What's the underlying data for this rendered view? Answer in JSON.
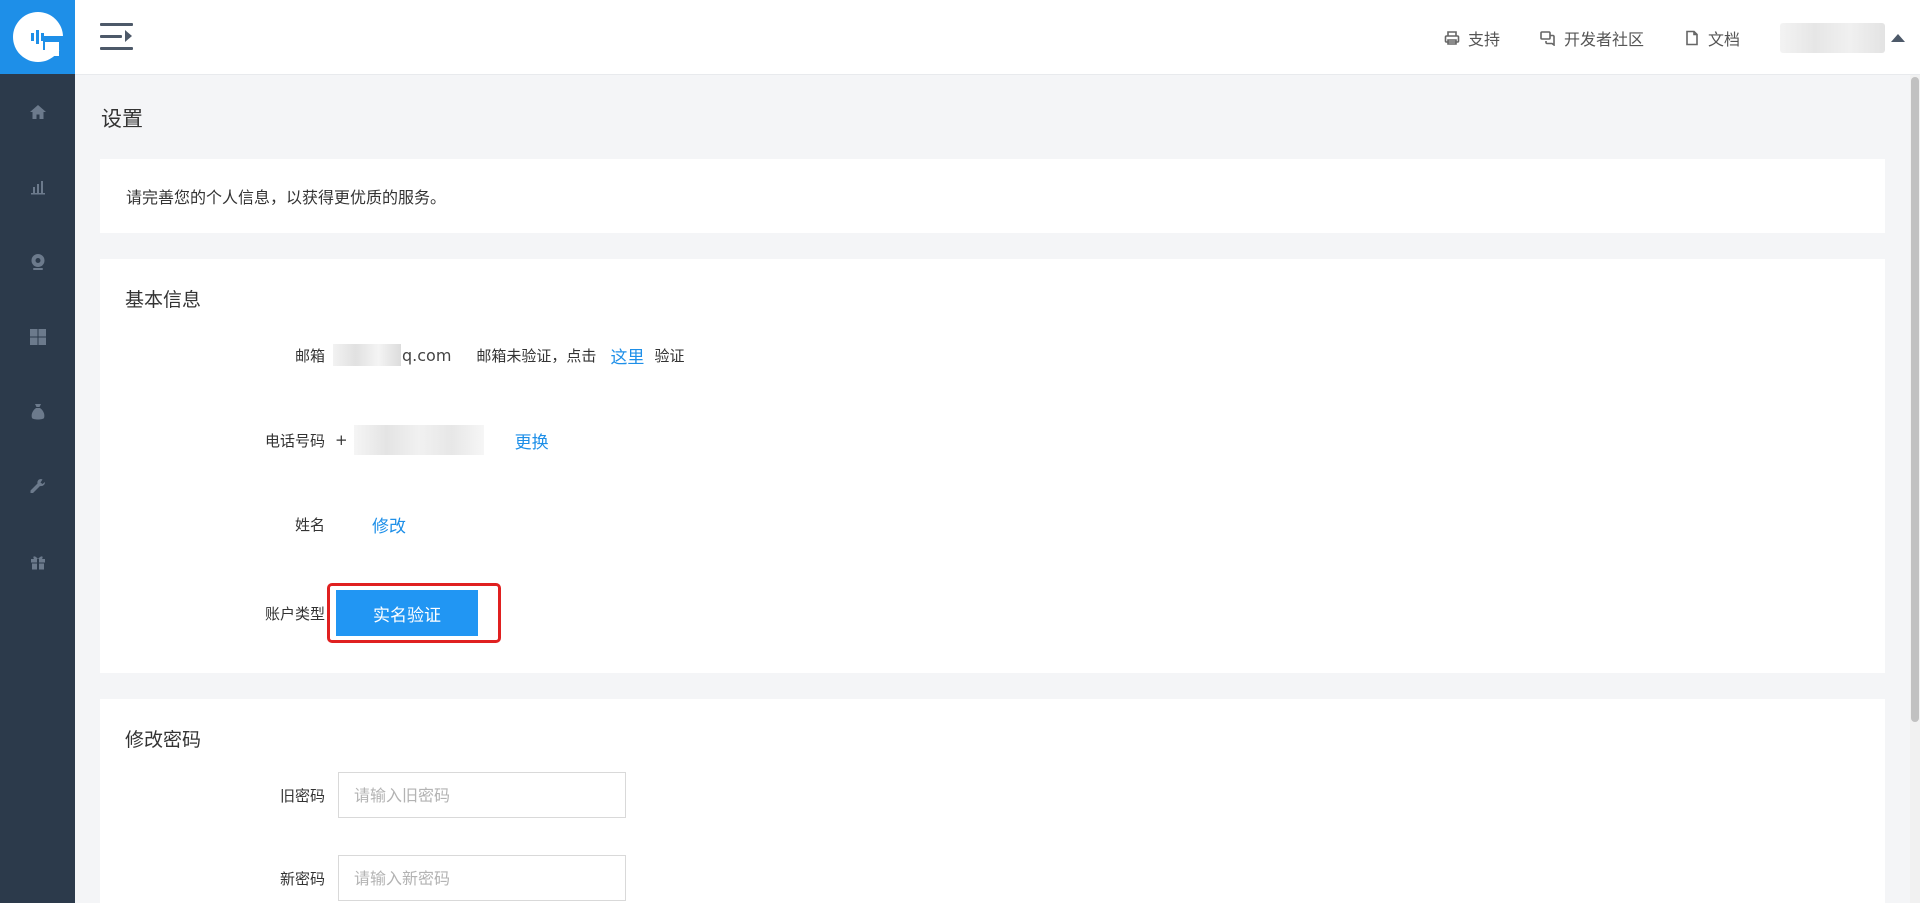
{
  "colors": {
    "sidebar_bg": "#2c3a4b",
    "accent": "#1e8fe8",
    "button_bg": "#2196f3",
    "highlight_border": "#e02020"
  },
  "sidebar": {
    "items": [
      {
        "icon": "home-icon"
      },
      {
        "icon": "bar-chart-icon"
      },
      {
        "icon": "webcam-icon"
      },
      {
        "icon": "grid-icon"
      },
      {
        "icon": "money-bag-icon"
      },
      {
        "icon": "wrench-icon"
      },
      {
        "icon": "gift-icon"
      }
    ]
  },
  "header": {
    "links": [
      {
        "label": "支持",
        "icon": "printer-icon"
      },
      {
        "label": "开发者社区",
        "icon": "chat-bubbles-icon"
      },
      {
        "label": "文档",
        "icon": "document-icon"
      }
    ]
  },
  "page": {
    "title": "设置",
    "notice": "请完善您的个人信息，以获得更优质的服务。"
  },
  "basic_info": {
    "title": "基本信息",
    "email": {
      "label": "邮箱",
      "value_suffix": "q.com",
      "status_text": "邮箱未验证，点击",
      "link": "这里",
      "after_link": "验证"
    },
    "phone": {
      "label": "电话号码",
      "prefix": "+",
      "change_link": "更换"
    },
    "name": {
      "label": "姓名",
      "edit_link": "修改"
    },
    "account_type": {
      "label": "账户类型",
      "button": "实名验证"
    }
  },
  "password": {
    "title": "修改密码",
    "old_label": "旧密码",
    "old_placeholder": "请输入旧密码",
    "new_label": "新密码",
    "new_placeholder": "请输入新密码"
  }
}
